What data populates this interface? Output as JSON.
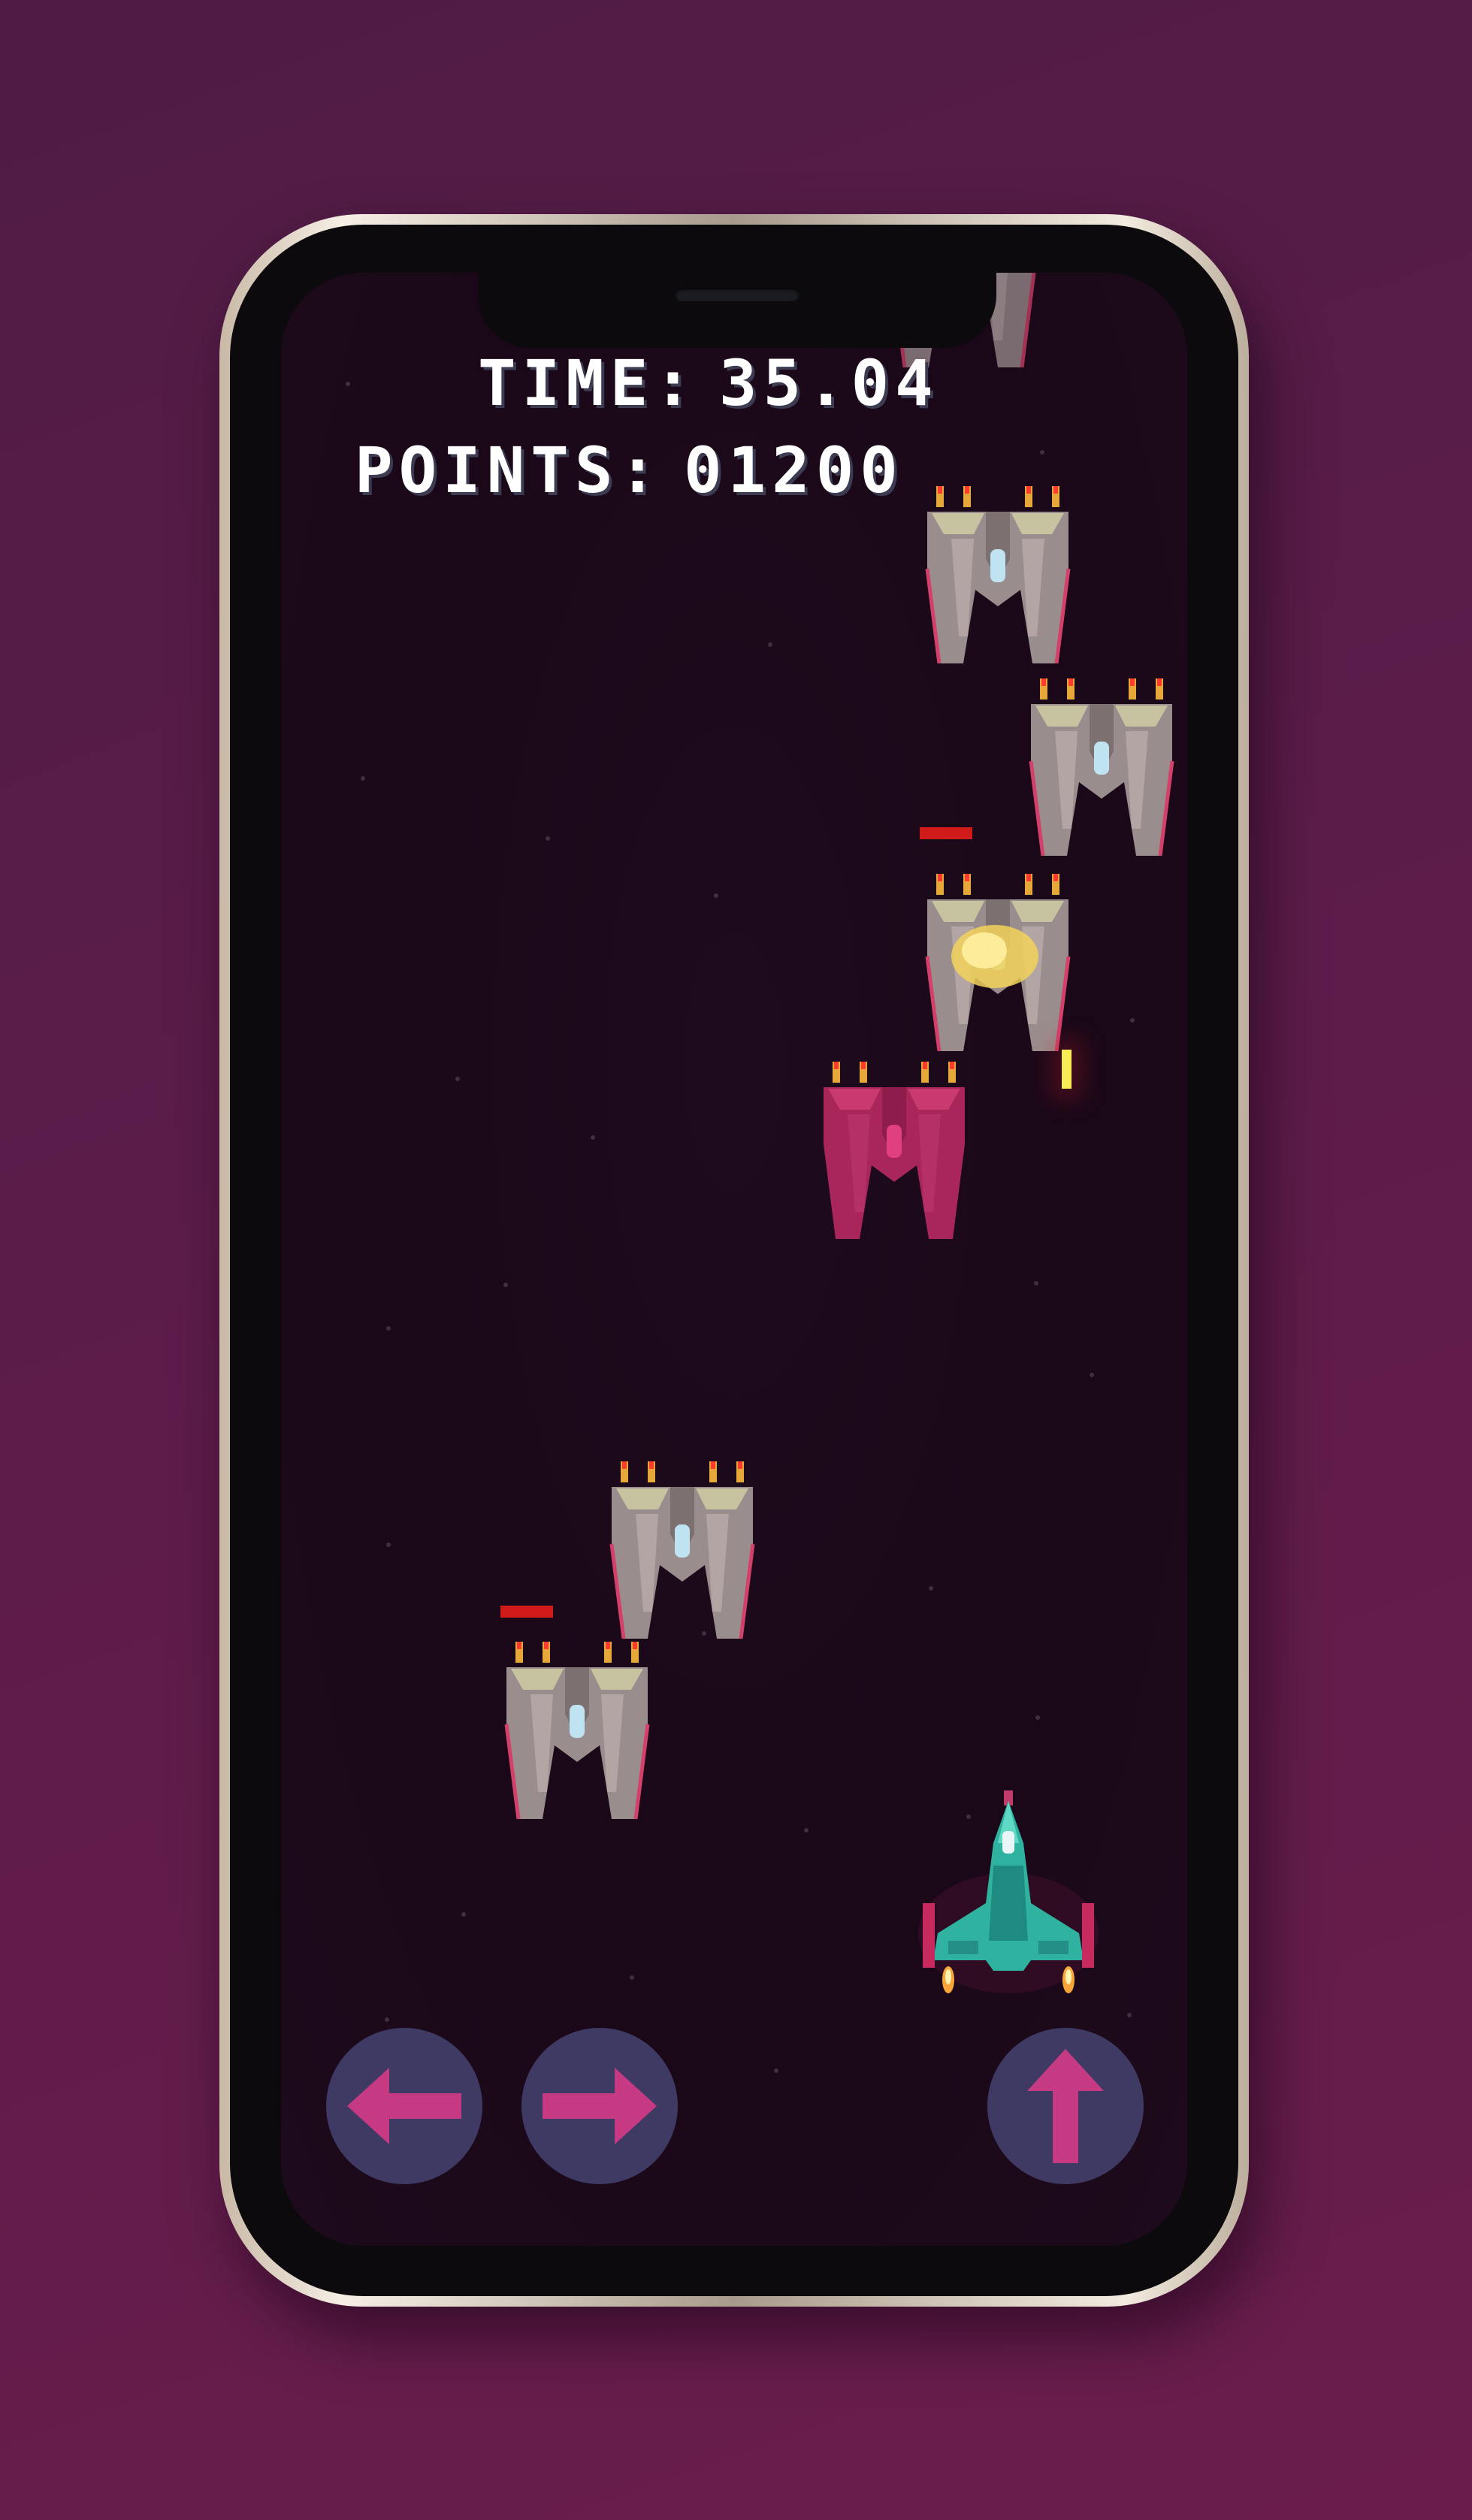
{
  "hud": {
    "time_label": "TIME:",
    "time_value": "35.04",
    "points_label": "POINTS:",
    "points_value": "01200"
  },
  "controls": {
    "left_icon": "arrow-left-icon",
    "right_icon": "arrow-right-icon",
    "fire_icon": "arrow-up-icon"
  },
  "colors": {
    "background": "#5e1c4b",
    "screen": "#1a0818",
    "control_button": "#3e3a63",
    "control_arrow": "#c53a83",
    "enemy_hull": "#9a8d8d",
    "enemy_damaged": "#b8245e",
    "player_hull": "#2fb3a0",
    "health_bar": "#d11a1a",
    "bullet": "#f7ec54"
  }
}
